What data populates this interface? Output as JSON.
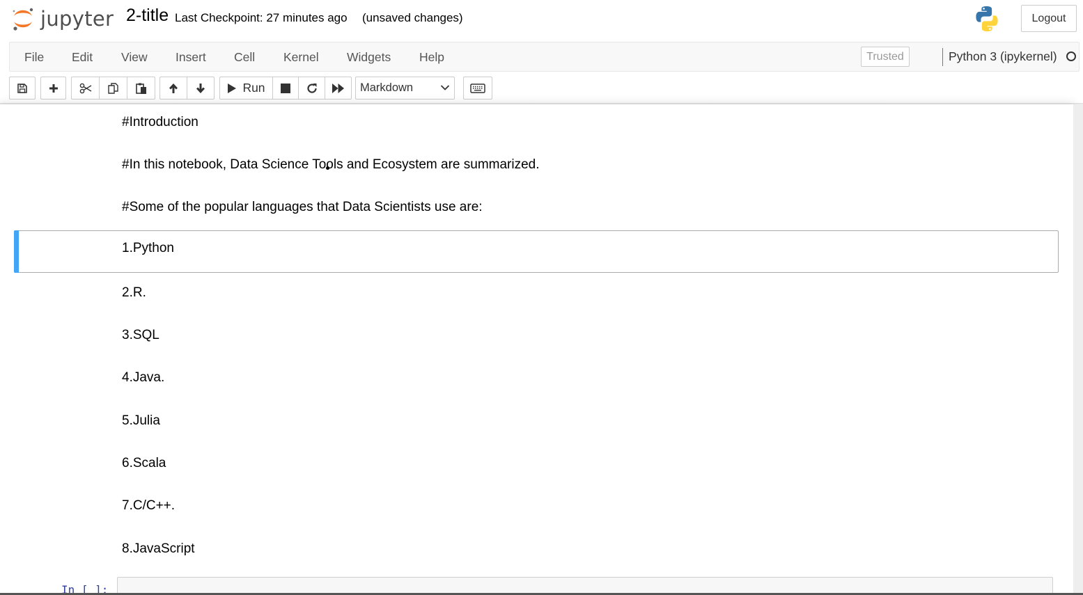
{
  "header": {
    "logo_text": "jupyter",
    "notebook_name": "2-title",
    "checkpoint": "Last Checkpoint: 27 minutes ago",
    "status": "(unsaved changes)",
    "logout_label": "Logout",
    "python_logo_icon": "python-logo-icon",
    "colors": {
      "jupyter_orange": "#f37726",
      "python_blue": "#3776ab",
      "python_yellow": "#ffd43b"
    }
  },
  "menubar": {
    "items": [
      "File",
      "Edit",
      "View",
      "Insert",
      "Cell",
      "Kernel",
      "Widgets",
      "Help"
    ],
    "trusted_label": "Trusted",
    "kernel_name": "Python 3 (ipykernel)",
    "kernel_state": "idle"
  },
  "toolbar": {
    "save_icon": "save-icon",
    "insert_icon": "plus-icon",
    "cut_icon": "scissors-icon",
    "copy_icon": "copy-icon",
    "paste_icon": "paste-icon",
    "move_up_icon": "arrow-up-icon",
    "move_down_icon": "arrow-down-icon",
    "run_label": "Run",
    "interrupt_icon": "stop-icon",
    "restart_icon": "restart-icon",
    "restart_run_all_icon": "fast-forward-icon",
    "cell_type": "Markdown",
    "command_palette_icon": "keyboard-icon"
  },
  "notebook": {
    "cells": [
      {
        "type": "markdown",
        "text": "#Introduction",
        "selected": false
      },
      {
        "type": "markdown",
        "text": "#In this notebook, Data Science Tools and Ecosystem are summarized.",
        "selected": false
      },
      {
        "type": "markdown",
        "text": "#Some of the popular languages that Data Scientists use are:",
        "selected": false
      },
      {
        "type": "markdown",
        "text": "1.Python",
        "selected": true
      },
      {
        "type": "markdown",
        "text": "2.R.",
        "selected": false
      },
      {
        "type": "markdown",
        "text": "3.SQL",
        "selected": false
      },
      {
        "type": "markdown",
        "text": "4.Java.",
        "selected": false
      },
      {
        "type": "markdown",
        "text": "5.Julia",
        "selected": false
      },
      {
        "type": "markdown",
        "text": "6.Scala",
        "selected": false
      },
      {
        "type": "markdown",
        "text": "7.C/C++.",
        "selected": false
      },
      {
        "type": "markdown",
        "text": "8.JavaScript",
        "selected": false
      }
    ],
    "code_cell_prompt": "In [ ]:",
    "selection_color": "#42a5f5"
  }
}
